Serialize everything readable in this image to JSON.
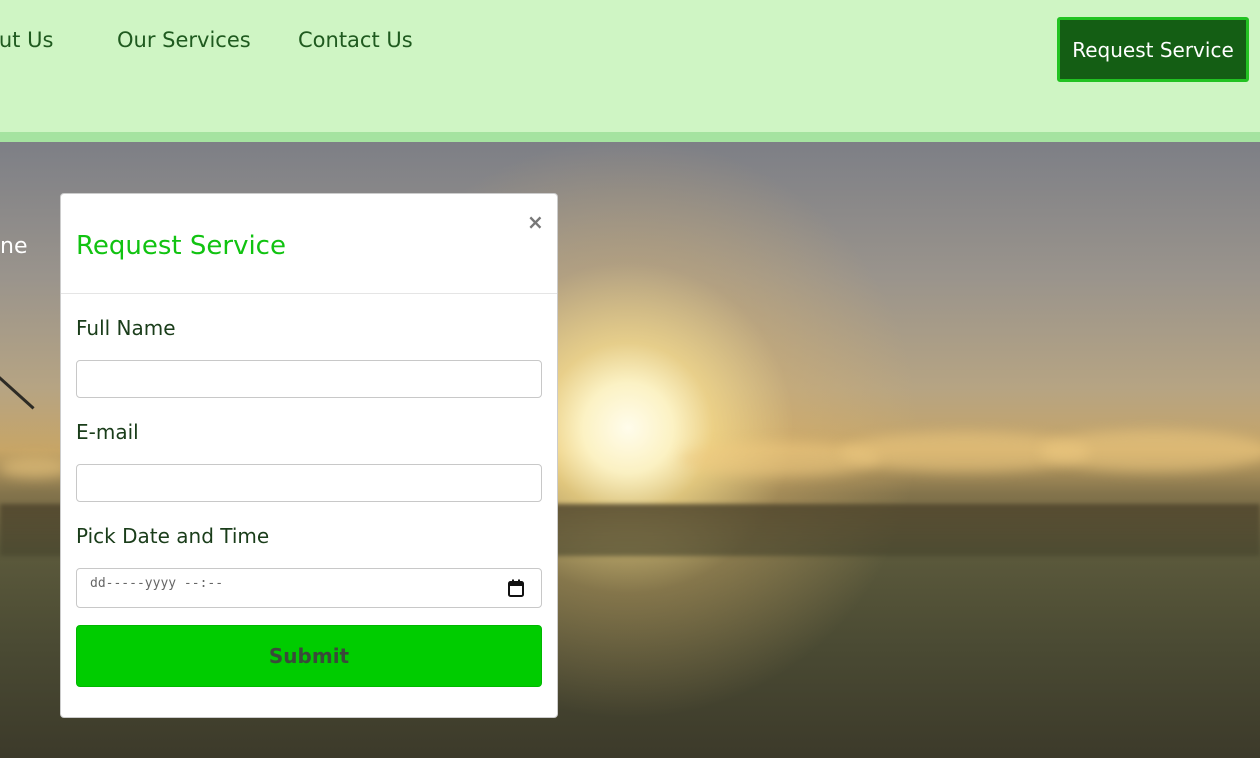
{
  "nav": {
    "links": [
      "out Us",
      "Our Services",
      "Contact Us"
    ],
    "cta_label": "Request Service"
  },
  "hero": {
    "partial_text": "ne"
  },
  "modal": {
    "title": "Request Service",
    "close_symbol": "×",
    "fields": {
      "name_label": "Full Name",
      "name_value": "",
      "email_label": "E-mail",
      "email_value": "",
      "date_label": "Pick Date and Time",
      "date_placeholder": "dd-----yyyy --:--"
    },
    "submit_label": "Submit"
  },
  "icons": {
    "close": "close-icon",
    "calendar": "calendar-icon"
  },
  "colors": {
    "nav_bg": "#cff5c4",
    "nav_border": "#a5e3a0",
    "cta_bg": "#145e14",
    "cta_border": "#22c222",
    "modal_title": "#11c311",
    "submit_bg": "#00cc00"
  }
}
